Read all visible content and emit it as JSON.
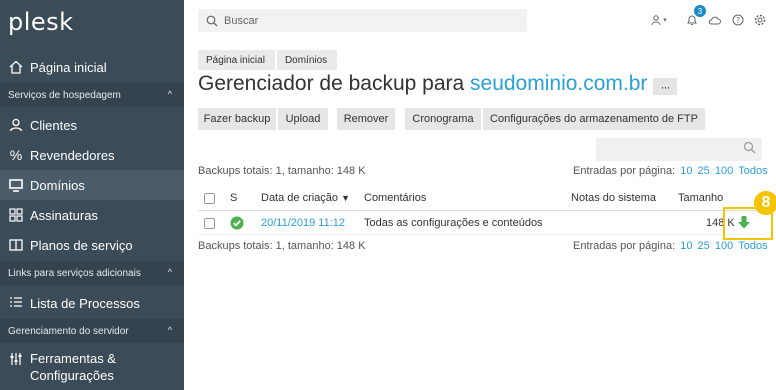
{
  "logo": "plesk",
  "sidebar": {
    "home": "Página inicial",
    "section_hosting": "Serviços de hospedagem",
    "clients": "Clientes",
    "resellers": "Revendedores",
    "domains": "Domínios",
    "subscriptions": "Assinaturas",
    "service_plans": "Planos de serviço",
    "section_links": "Links para serviços adicionais",
    "process_list": "Lista de Processos",
    "section_server": "Gerenciamento do servidor",
    "tools_line1": "Ferramentas &",
    "tools_line2": "Configurações"
  },
  "topbar": {
    "search_placeholder": "Buscar",
    "notification_count": "3"
  },
  "breadcrumb": [
    "Página inicial",
    "Domínios"
  ],
  "title": {
    "prefix": "Gerenciador de backup para ",
    "domain": "seudominio.com.br",
    "more": "···"
  },
  "toolbar": {
    "backup": "Fazer backup",
    "upload": "Upload",
    "remove": "Remover",
    "schedule": "Cronograma",
    "ftp": "Configurações do armazenamento de FTP"
  },
  "summary": "Backups totais: 1, tamanho: 148 K",
  "pager": {
    "label": "Entradas por página:",
    "options": [
      "10",
      "25",
      "100",
      "Todos"
    ]
  },
  "table": {
    "columns": {
      "s": "S",
      "date": "Data de criação",
      "comments": "Comentários",
      "notes": "Notas do sistema",
      "size": "Tamanho"
    },
    "rows": [
      {
        "date": "20/11/2019 11:12",
        "comment": "Todas as configurações e conteúdos",
        "notes": "",
        "size": "148 K"
      }
    ]
  },
  "step_badge": "8",
  "colors": {
    "sidebar": "#3b4b57",
    "link": "#2aa0d8",
    "highlight": "#f4c400",
    "success": "#4caf50"
  }
}
